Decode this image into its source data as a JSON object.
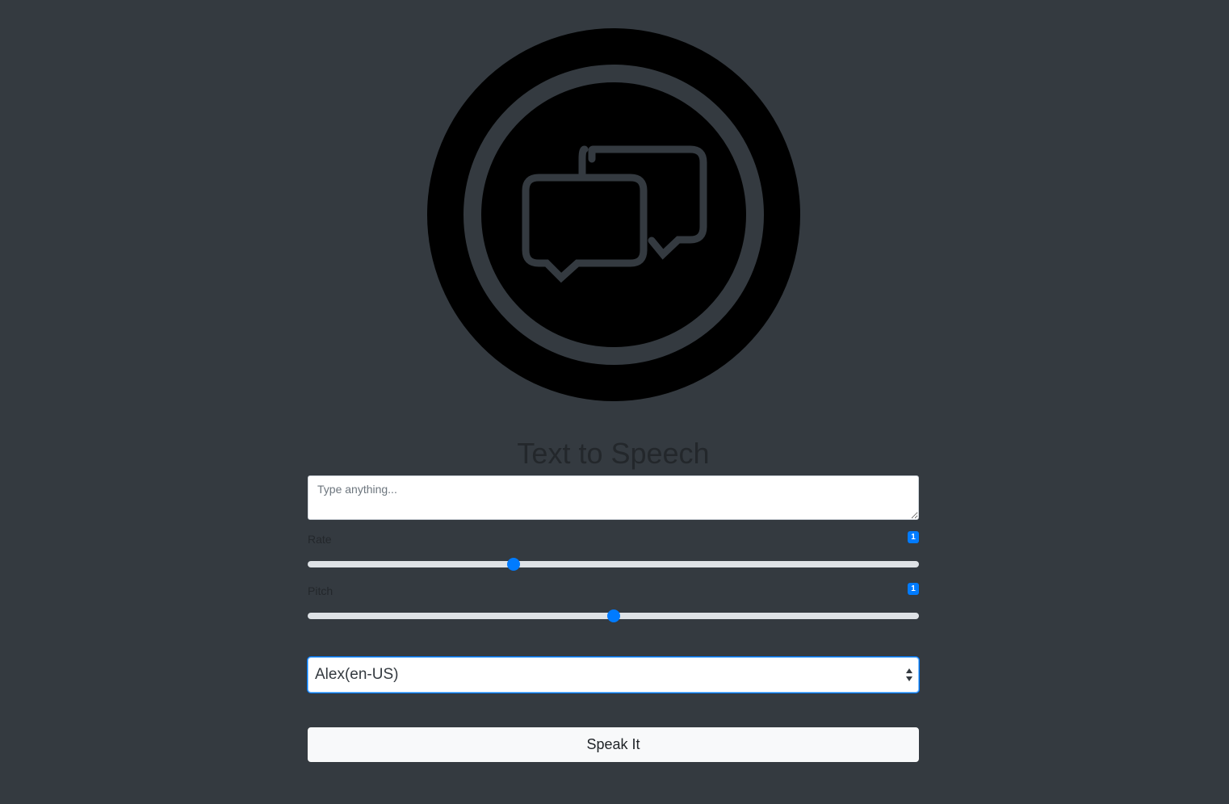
{
  "app": {
    "title": "Text to Speech",
    "logo_icon": "speech-bubbles-icon"
  },
  "text_input": {
    "placeholder": "Type anything...",
    "value": ""
  },
  "rate": {
    "label": "Rate",
    "badge": "1",
    "min": 0.5,
    "max": 2,
    "value": 1
  },
  "pitch": {
    "label": "Pitch",
    "badge": "1",
    "min": 0,
    "max": 2,
    "value": 1
  },
  "voice_select": {
    "selected": "Alex(en-US)",
    "arrows_icon": "select-arrows-icon"
  },
  "speak_button": {
    "label": "Speak It"
  },
  "colors": {
    "background": "#343a40",
    "accent": "#007bff",
    "logo_fill": "#000000",
    "logo_stroke": "#343a40",
    "button_bg": "#f8f9fa"
  }
}
